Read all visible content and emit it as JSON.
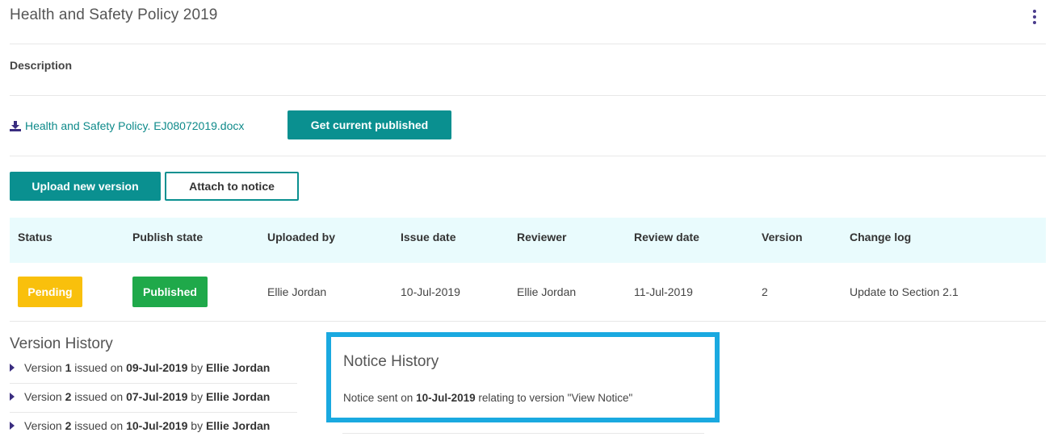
{
  "header": {
    "title": "Health and Safety Policy 2019",
    "menu_icon": "kebab-vertical-icon"
  },
  "description": {
    "label": "Description"
  },
  "file": {
    "icon": "download-icon",
    "name": "Health and Safety Policy. EJ08072019.docx",
    "get_published_label": "Get current published"
  },
  "actions": {
    "upload_label": "Upload new version",
    "attach_label": "Attach to notice"
  },
  "table": {
    "headers": [
      "Status",
      "Publish state",
      "Uploaded by",
      "Issue date",
      "Reviewer",
      "Review date",
      "Version",
      "Change log"
    ],
    "row": {
      "status": "Pending",
      "publish_state": "Published",
      "uploaded_by": "Ellie Jordan",
      "issue_date": "10-Jul-2019",
      "reviewer": "Ellie Jordan",
      "review_date": "11-Jul-2019",
      "version": "2",
      "change_log": "Update to Section 2.1"
    }
  },
  "version_history": {
    "title": "Version History",
    "items": [
      {
        "prefix": "Version ",
        "version": "1",
        "mid": " issued on ",
        "date": "09-Jul-2019",
        "by": " by ",
        "user": "Ellie Jordan"
      },
      {
        "prefix": "Version ",
        "version": "2",
        "mid": " issued on ",
        "date": "07-Jul-2019",
        "by": " by ",
        "user": "Ellie Jordan"
      },
      {
        "prefix": "Version ",
        "version": "2",
        "mid": " issued on ",
        "date": "10-Jul-2019",
        "by": " by ",
        "user": "Ellie Jordan"
      }
    ]
  },
  "notice_history": {
    "title": "Notice History",
    "prefix": "Notice sent on ",
    "date": "10-Jul-2019",
    "suffix": " relating to version \"View Notice\""
  },
  "colors": {
    "accent": "#0a9090",
    "pending": "#f9c00c",
    "published": "#1fa94a",
    "highlight": "#1aa9e0",
    "table_header_bg": "#e9fbfd",
    "link": "#0e8a8a"
  }
}
